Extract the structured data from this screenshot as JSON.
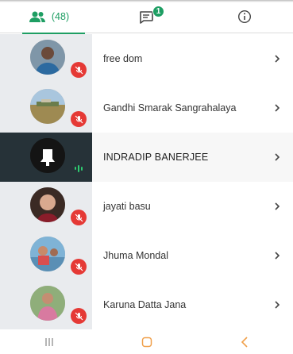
{
  "tabs": {
    "people_count": "(48)",
    "chat_unread": "1"
  },
  "participants": [
    {
      "name": "free dom",
      "muted": true,
      "active": false
    },
    {
      "name": "Gandhi Smarak Sangrahalaya",
      "muted": true,
      "active": false
    },
    {
      "name": "INDRADIP BANERJEE",
      "muted": false,
      "active": true
    },
    {
      "name": "jayati basu",
      "muted": true,
      "active": false
    },
    {
      "name": "Jhuma Mondal",
      "muted": true,
      "active": false
    },
    {
      "name": "Karuna Datta Jana",
      "muted": true,
      "active": false
    }
  ],
  "colors": {
    "accent": "#1e9e63",
    "mute": "#e53935",
    "active_bg": "#263238"
  },
  "icons": {
    "people_tab": "people-icon",
    "chat_tab": "chat-icon",
    "info_tab": "info-icon",
    "nav_recent": "recent-apps-icon",
    "nav_home": "home-icon",
    "nav_back": "back-icon"
  }
}
